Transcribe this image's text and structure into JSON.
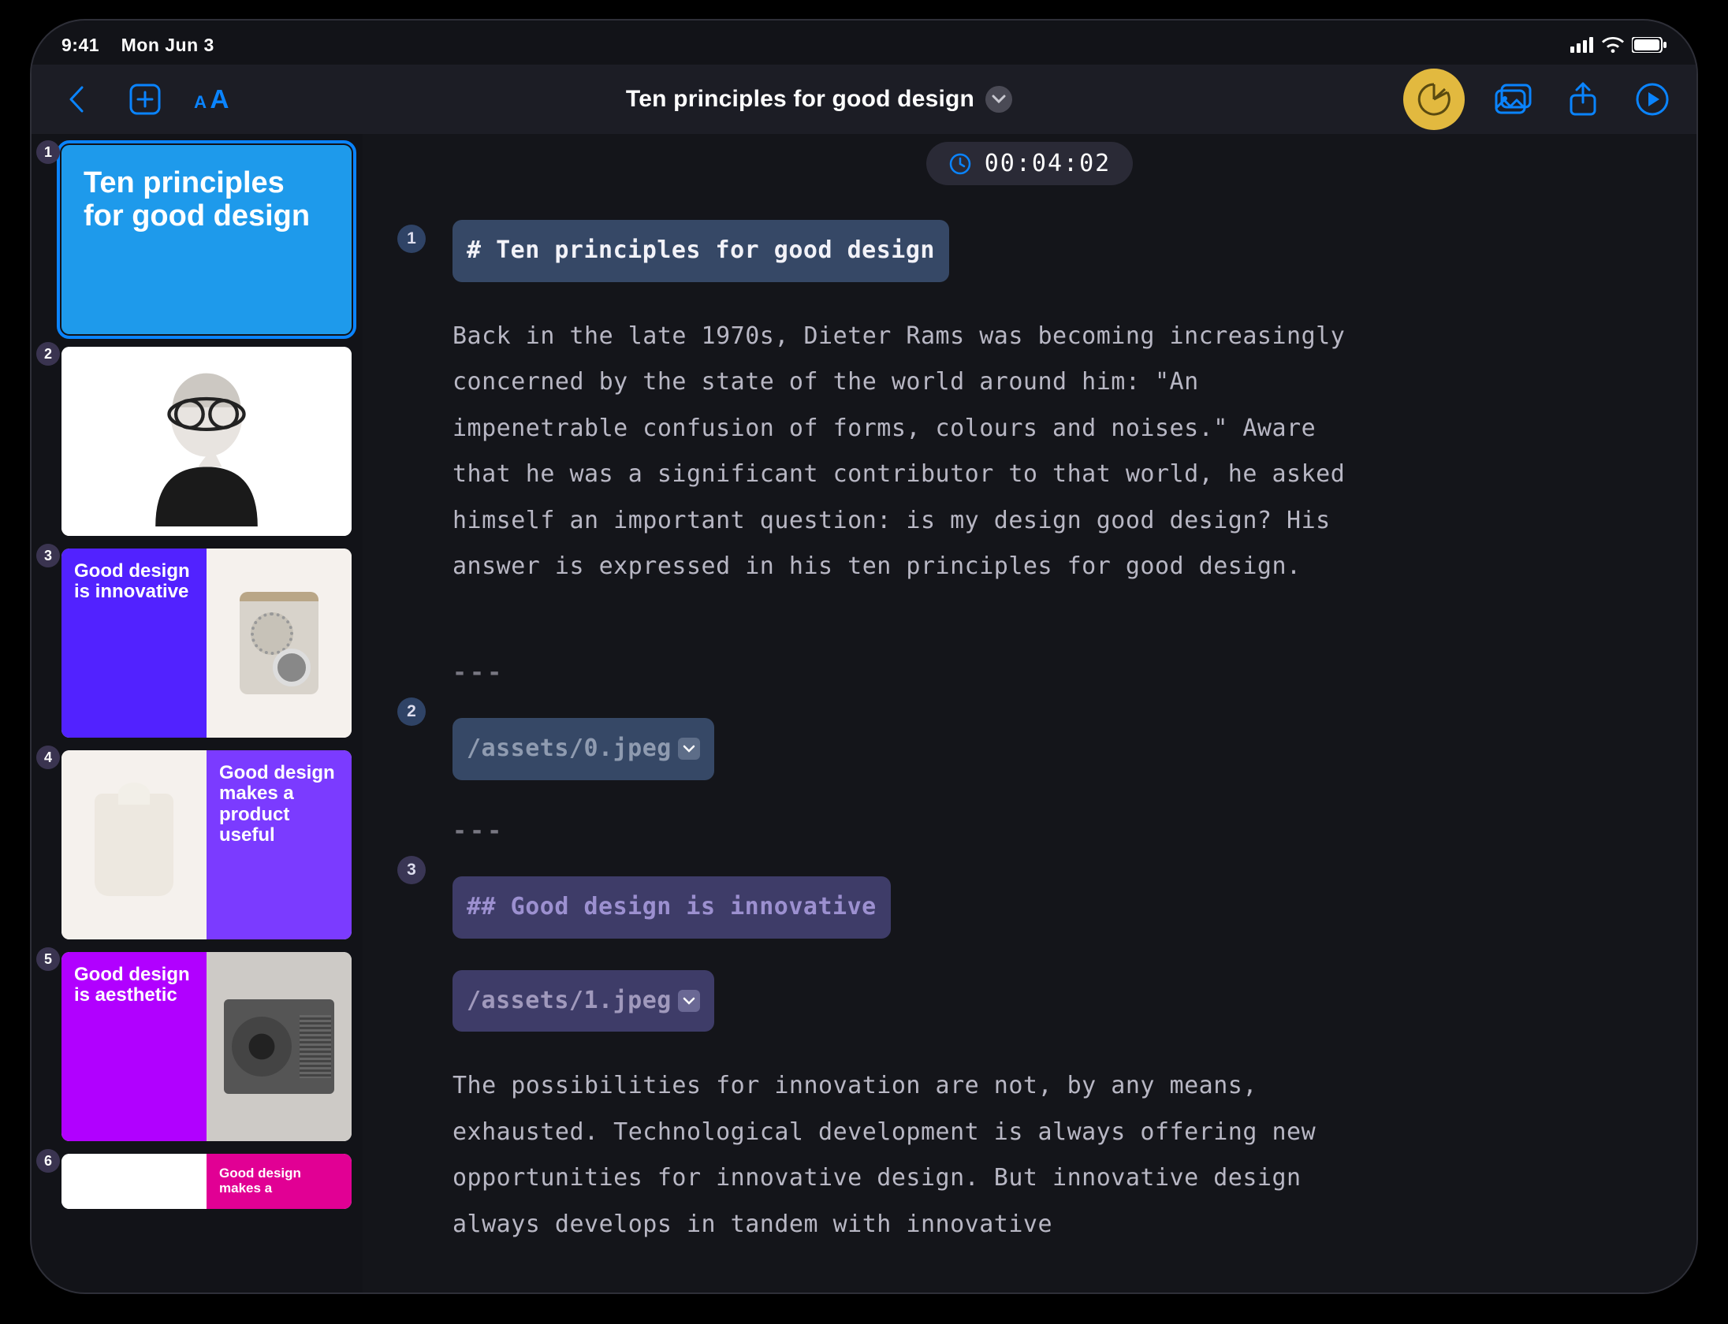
{
  "status_bar": {
    "time": "9:41",
    "date": "Mon Jun 3"
  },
  "toolbar": {
    "title": "Ten principles for good design"
  },
  "timer": {
    "value": "00:04:02"
  },
  "thumbnails": [
    {
      "num": "1",
      "title": "Ten principles for good design"
    },
    {
      "num": "2",
      "title": ""
    },
    {
      "num": "3",
      "title": "Good design is innovative"
    },
    {
      "num": "4",
      "title": "Good design makes a product useful"
    },
    {
      "num": "5",
      "title": "Good design is aesthetic"
    },
    {
      "num": "6",
      "title": "Good design makes a"
    }
  ],
  "editor": {
    "sections": [
      {
        "num": "1",
        "heading": "# Ten principles for good design",
        "body": "Back in the late 1970s, Dieter Rams was becoming increasingly concerned by the state of the world around him: \"An impenetrable confusion of forms, colours and noises.\" Aware that he was a significant contributor to that world, he asked himself an important question: is my design good design? His answer is expressed in his ten principles for good design."
      },
      {
        "num": "2",
        "hr": "---",
        "asset": "/assets/0.jpeg"
      },
      {
        "num": "3",
        "hr": "---",
        "heading": "## Good design is innovative",
        "asset": "/assets/1.jpeg",
        "body": "The possibilities for innovation are not, by any means, exhausted. Technological development is always offering new opportunities for innovative design. But innovative design always develops in tandem with innovative"
      }
    ]
  }
}
